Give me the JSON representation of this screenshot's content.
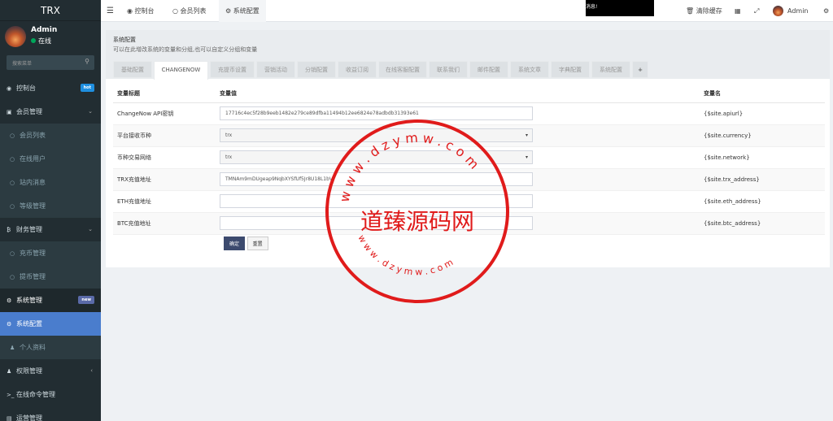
{
  "brand": "TRX",
  "user": {
    "name": "Admin",
    "status": "在线"
  },
  "search": {
    "placeholder": "搜索菜单"
  },
  "menu": {
    "dashboard": {
      "label": "控制台",
      "badge": "hot"
    },
    "members": {
      "label": "会员管理"
    },
    "members_list": {
      "label": "会员列表"
    },
    "online_users": {
      "label": "在线用户"
    },
    "site_messages": {
      "label": "站内消息"
    },
    "levels": {
      "label": "等级管理"
    },
    "finance": {
      "label": "财务管理"
    },
    "deposit": {
      "label": "充币管理"
    },
    "withdraw": {
      "label": "提币管理"
    },
    "system": {
      "label": "系统管理",
      "badge": "new"
    },
    "system_config": {
      "label": "系统配置"
    },
    "profile": {
      "label": "个人资料"
    },
    "permissions": {
      "label": "权限管理"
    },
    "online_cmd": {
      "label": "在线命令管理"
    },
    "operations": {
      "label": "运营管理"
    }
  },
  "topbar": {
    "tab_dashboard": "控制台",
    "tab_members": "会员列表",
    "tab_config": "系统配置",
    "notice": "消息!",
    "clear_cache": "清除缓存",
    "admin": "Admin"
  },
  "page": {
    "title": "系统配置",
    "desc": "可以在此增改系统的变量和分组,也可以自定义分组和变量"
  },
  "tabs": [
    "基础配置",
    "CHANGENOW",
    "充提币设置",
    "营销活动",
    "分销配置",
    "收益订阅",
    "在线客服配置",
    "联系我们",
    "邮件配置",
    "系统文章",
    "字典配置",
    "系统配置",
    "+"
  ],
  "table": {
    "headers": [
      "变量标题",
      "变量值",
      "变量名"
    ],
    "rows": [
      {
        "title": "ChangeNow API密钥",
        "value": "17716c4ec5f28b9eeb1482e279ce89dfba11494b12ee6824e78adbdb31393e61",
        "name": "{$site.apiurl}",
        "type": "text"
      },
      {
        "title": "平台接收币种",
        "value": "trx",
        "name": "{$site.currency}",
        "type": "select"
      },
      {
        "title": "币种交易网络",
        "value": "trx",
        "name": "{$site.network}",
        "type": "select"
      },
      {
        "title": "TRX充值地址",
        "value": "TMNAm9mDUgeap9NqbXYSfUf5Jr8U18L1bV",
        "name": "{$site.trx_address}",
        "type": "text"
      },
      {
        "title": "ETH充值地址",
        "value": "",
        "name": "{$site.eth_address}",
        "type": "text"
      },
      {
        "title": "BTC充值地址",
        "value": "",
        "name": "{$site.btc_address}",
        "type": "text"
      }
    ]
  },
  "buttons": {
    "confirm": "确定",
    "reset": "重置"
  },
  "watermark": {
    "center": "道臻源码网",
    "ring_top": "w w w . d z y m w . c o m",
    "ring_bottom": "w w w . d z y m w . c o m",
    "color": "#e01b1b"
  }
}
